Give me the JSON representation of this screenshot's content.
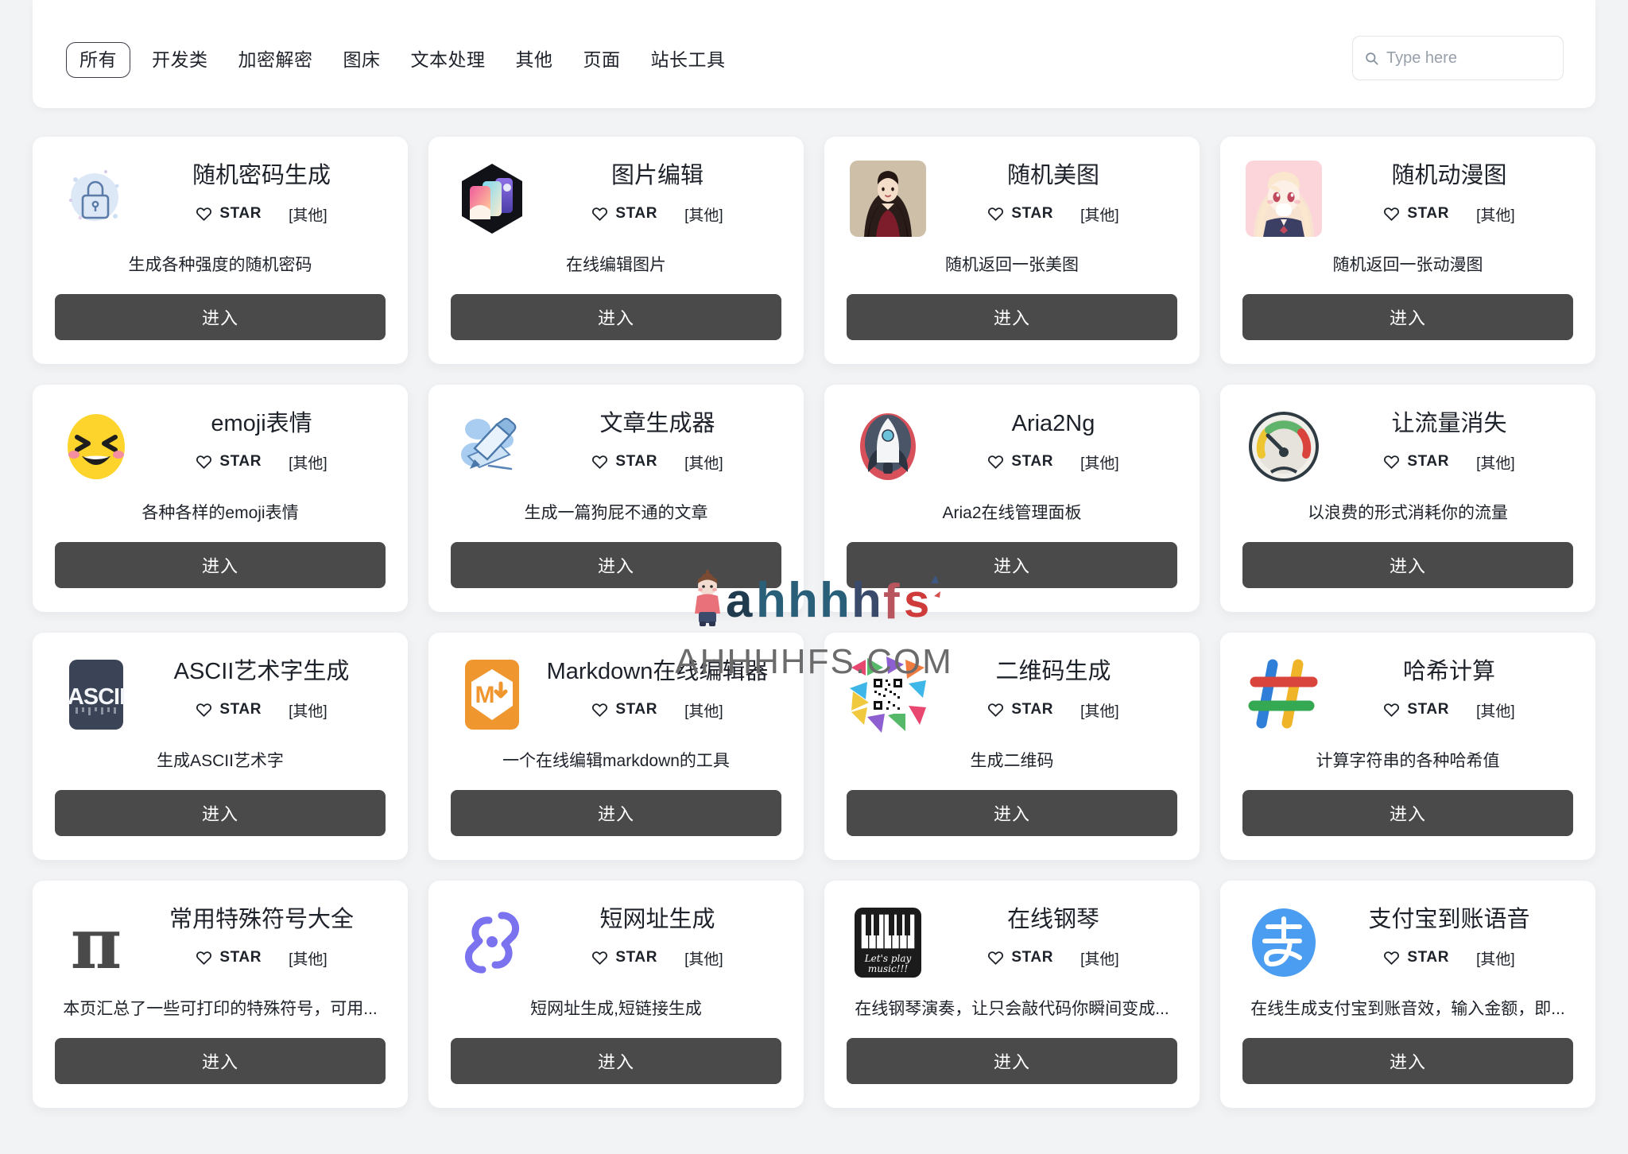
{
  "header": {
    "nav_items": [
      {
        "label": "所有",
        "active": true
      },
      {
        "label": "开发类",
        "active": false
      },
      {
        "label": "加密解密",
        "active": false
      },
      {
        "label": "图床",
        "active": false
      },
      {
        "label": "文本处理",
        "active": false
      },
      {
        "label": "其他",
        "active": false
      },
      {
        "label": "页面",
        "active": false
      },
      {
        "label": "站长工具",
        "active": false
      }
    ],
    "search": {
      "placeholder": "Type here",
      "value": "",
      "icon": "search-icon"
    }
  },
  "watermark": {
    "logo_text": "ahhhhfs",
    "domain_text": "AHHHHFS.COM"
  },
  "common": {
    "star_label": "STAR",
    "enter_label": "进入",
    "heart_icon": "heart-icon"
  },
  "cards": [
    {
      "title": "随机密码生成",
      "star": "STAR",
      "category": "[其他]",
      "desc": "生成各种强度的随机密码",
      "enter": "进入",
      "icon": "lock-icon"
    },
    {
      "title": "图片编辑",
      "star": "STAR",
      "category": "[其他]",
      "desc": "在线编辑图片",
      "enter": "进入",
      "icon": "photo-editor-hexagon-icon"
    },
    {
      "title": "随机美图",
      "star": "STAR",
      "category": "[其他]",
      "desc": "随机返回一张美图",
      "enter": "进入",
      "icon": "woman-photo-icon"
    },
    {
      "title": "随机动漫图",
      "star": "STAR",
      "category": "[其他]",
      "desc": "随机返回一张动漫图",
      "enter": "进入",
      "icon": "anime-girl-icon"
    },
    {
      "title": "emoji表情",
      "star": "STAR",
      "category": "[其他]",
      "desc": "各种各样的emoji表情",
      "enter": "进入",
      "icon": "laughing-emoji-icon"
    },
    {
      "title": "文章生成器",
      "star": "STAR",
      "category": "[其他]",
      "desc": "生成一篇狗屁不通的文章",
      "enter": "进入",
      "icon": "pencil-writing-icon"
    },
    {
      "title": "Aria2Ng",
      "star": "STAR",
      "category": "[其他]",
      "desc": "Aria2在线管理面板",
      "enter": "进入",
      "icon": "rocket-icon"
    },
    {
      "title": "让流量消失",
      "star": "STAR",
      "category": "[其他]",
      "desc": "以浪费的形式消耗你的流量",
      "enter": "进入",
      "icon": "speedometer-icon"
    },
    {
      "title": "ASCII艺术字生成",
      "star": "STAR",
      "category": "[其他]",
      "desc": "生成ASCII艺术字",
      "enter": "进入",
      "icon": "ascii-icon"
    },
    {
      "title": "Markdown在线编辑器",
      "star": "STAR",
      "category": "[其他]",
      "desc": "一个在线编辑markdown的工具",
      "enter": "进入",
      "icon": "markdown-icon"
    },
    {
      "title": "二维码生成",
      "star": "STAR",
      "category": "[其他]",
      "desc": "生成二维码",
      "enter": "进入",
      "icon": "qrcode-icon"
    },
    {
      "title": "哈希计算",
      "star": "STAR",
      "category": "[其他]",
      "desc": "计算字符串的各种哈希值",
      "enter": "进入",
      "icon": "hash-icon"
    },
    {
      "title": "常用特殊符号大全",
      "star": "STAR",
      "category": "[其他]",
      "desc": "本页汇总了一些可打印的特殊符号，可用...",
      "enter": "进入",
      "icon": "pi-symbol-icon"
    },
    {
      "title": "短网址生成",
      "star": "STAR",
      "category": "[其他]",
      "desc": "短网址生成,短链接生成",
      "enter": "进入",
      "icon": "link-chain-icon"
    },
    {
      "title": "在线钢琴",
      "star": "STAR",
      "category": "[其他]",
      "desc": "在线钢琴演奏，让只会敲代码你瞬间变成...",
      "enter": "进入",
      "icon": "piano-icon"
    },
    {
      "title": "支付宝到账语音",
      "star": "STAR",
      "category": "[其他]",
      "desc": "在线生成支付宝到账音效，输入金额，即...",
      "enter": "进入",
      "icon": "alipay-icon"
    }
  ],
  "colors": {
    "page_bg": "#f2f3f5",
    "card_bg": "#ffffff",
    "button_bg": "#4a4a4a",
    "text": "#1d2129",
    "placeholder": "#98a0ab"
  }
}
